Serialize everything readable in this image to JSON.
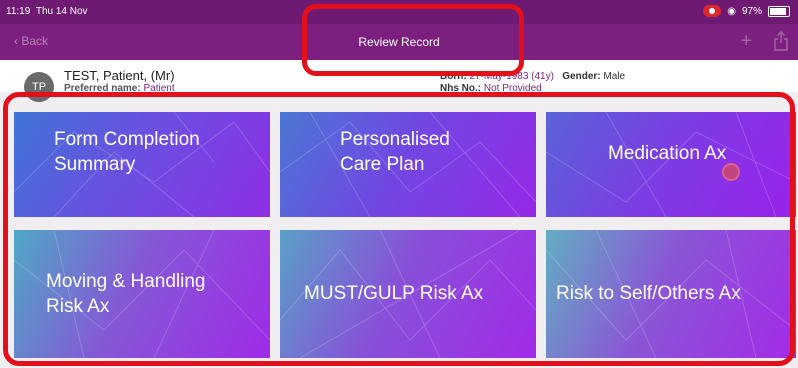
{
  "status": {
    "time": "11:19",
    "date": "Thu 14 Nov",
    "battery": "97%"
  },
  "nav": {
    "back": "Back",
    "title": "Review Record"
  },
  "patient": {
    "initials": "TP",
    "name": "TEST, Patient, (Mr)",
    "preferred_label": "Preferred name:",
    "preferred_value": "Patient",
    "born_label": "Born:",
    "born_value": "27-May-1983 (41y)",
    "gender_label": "Gender:",
    "gender_value": "Male",
    "nhs_label": "Nhs No.:",
    "nhs_value": "Not Provided"
  },
  "tiles": [
    {
      "label_line1": "Form Completion",
      "label_line2": "Summary"
    },
    {
      "label_line1": "Personalised",
      "label_line2": "Care Plan"
    },
    {
      "label_line1": "Medication Ax",
      "label_line2": ""
    },
    {
      "label_line1": "Moving & Handling",
      "label_line2": "Risk Ax"
    },
    {
      "label_line1": "MUST/GULP Risk Ax",
      "label_line2": ""
    },
    {
      "label_line1": "Risk to Self/Others Ax",
      "label_line2": ""
    }
  ],
  "colors": {
    "nav": "#7c1f7f",
    "highlight": "#e3101c"
  }
}
